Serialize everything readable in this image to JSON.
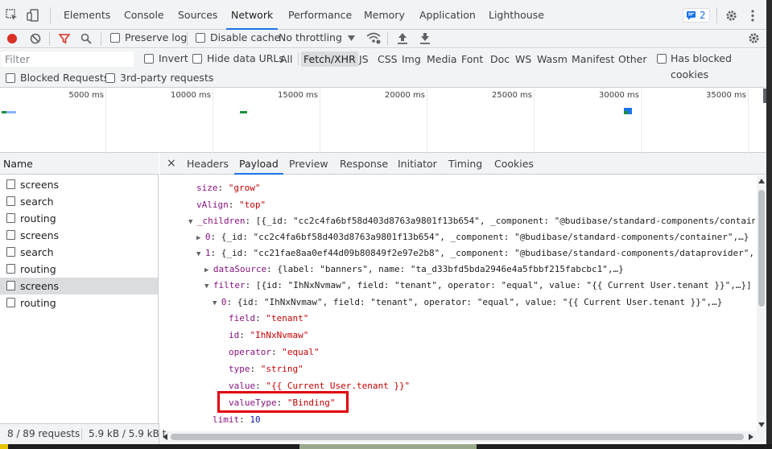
{
  "tabs": [
    "Elements",
    "Console",
    "Sources",
    "Network",
    "Performance",
    "Memory",
    "Application",
    "Lighthouse"
  ],
  "active_tab": "Network",
  "issues_count": "2",
  "toolbar": {
    "preserve_log": "Preserve log",
    "disable_cache": "Disable cache",
    "throttling": "No throttling"
  },
  "filter": {
    "placeholder": "Filter",
    "invert": "Invert",
    "hide_data_urls": "Hide data URLs",
    "types": [
      "All",
      "Fetch/XHR",
      "JS",
      "CSS",
      "Img",
      "Media",
      "Font",
      "Doc",
      "WS",
      "Wasm",
      "Manifest",
      "Other"
    ],
    "selected_type": "Fetch/XHR",
    "has_blocked_cookies": "Has blocked cookies",
    "blocked_requests": "Blocked Requests",
    "third_party": "3rd-party requests"
  },
  "overview": {
    "ticks": [
      "5000 ms",
      "10000 ms",
      "15000 ms",
      "20000 ms",
      "25000 ms",
      "30000 ms",
      "35000 ms"
    ]
  },
  "requests": {
    "header": "Name",
    "rows": [
      "screens",
      "search",
      "routing",
      "screens",
      "search",
      "routing",
      "screens",
      "routing"
    ],
    "selected_index": 6
  },
  "detail": {
    "close": "×",
    "tabs": [
      "Headers",
      "Payload",
      "Preview",
      "Response",
      "Initiator",
      "Timing",
      "Cookies"
    ],
    "active_tab": "Payload"
  },
  "payload": {
    "size_key": "size",
    "size_val": "\"grow\"",
    "valign_key": "vAlign",
    "valign_val": "\"top\"",
    "children_key": "_children",
    "children_val": "[{_id: \"cc2c4fa6bf58d403d8763a9801f13b654\", _component: \"@budibase/standard-components/contain",
    "c0_key": "0",
    "c0_val": "{_id: \"cc2c4fa6bf58d403d8763a9801f13b654\", _component: \"@budibase/standard-components/container\",…}",
    "c1_key": "1",
    "c1_val": "{_id: \"cc21fae8aa0ef44d09b80849f2e97e2b8\", _component: \"@budibase/standard-components/dataprovider\",",
    "datasource_key": "dataSource",
    "datasource_val": "{label: \"banners\", name: \"ta_d33bfd5bda2946e4a5fbbf215fabcbc1\",…}",
    "filter_key": "filter",
    "filter_val": "[{id: \"IhNxNvmaw\", field: \"tenant\", operator: \"equal\", value: \"{{ Current User.tenant }}\",…}]",
    "f0_key": "0",
    "f0_val": "{id: \"IhNxNvmaw\", field: \"tenant\", operator: \"equal\", value: \"{{ Current User.tenant }}\",…}",
    "field_key": "field",
    "field_val": "\"tenant\"",
    "id_key": "id",
    "id_val": "\"IhNxNvmaw\"",
    "operator_key": "operator",
    "operator_val": "\"equal\"",
    "type_key": "type",
    "type_val": "\"string\"",
    "value_key": "value",
    "value_val": "\"{{ Current User.tenant }}\"",
    "valuetype_key": "valueType",
    "valuetype_val": "\"Binding\"",
    "limit_key": "limit",
    "limit_val": "10"
  },
  "status": {
    "requests": "8 / 89 requests",
    "transferred": "5.9 kB / 5.9 kB t"
  },
  "colors": {
    "accent": "#1a73e8",
    "record": "#d93025",
    "highlight": "#e0000d"
  }
}
